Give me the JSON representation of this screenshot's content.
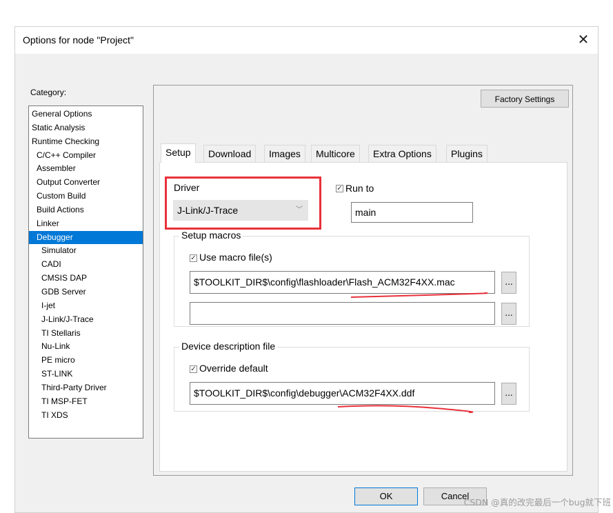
{
  "window": {
    "title": "Options for node \"Project\"",
    "close_icon": "close-icon"
  },
  "category": {
    "label": "Category:",
    "items": [
      {
        "label": "General Options",
        "level": 0
      },
      {
        "label": "Static Analysis",
        "level": 0
      },
      {
        "label": "Runtime Checking",
        "level": 0
      },
      {
        "label": "C/C++ Compiler",
        "level": 1
      },
      {
        "label": "Assembler",
        "level": 1
      },
      {
        "label": "Output Converter",
        "level": 1
      },
      {
        "label": "Custom Build",
        "level": 1
      },
      {
        "label": "Build Actions",
        "level": 1
      },
      {
        "label": "Linker",
        "level": 1
      },
      {
        "label": "Debugger",
        "level": 1,
        "selected": true
      },
      {
        "label": "Simulator",
        "level": 2
      },
      {
        "label": "CADI",
        "level": 2
      },
      {
        "label": "CMSIS DAP",
        "level": 2
      },
      {
        "label": "GDB Server",
        "level": 2
      },
      {
        "label": "I-jet",
        "level": 2
      },
      {
        "label": "J-Link/J-Trace",
        "level": 2
      },
      {
        "label": "TI Stellaris",
        "level": 2
      },
      {
        "label": "Nu-Link",
        "level": 2
      },
      {
        "label": "PE micro",
        "level": 2
      },
      {
        "label": "ST-LINK",
        "level": 2
      },
      {
        "label": "Third-Party Driver",
        "level": 2
      },
      {
        "label": "TI MSP-FET",
        "level": 2
      },
      {
        "label": "TI XDS",
        "level": 2
      }
    ]
  },
  "factory_settings_label": "Factory Settings",
  "tabs": [
    "Setup",
    "Download",
    "Images",
    "Multicore",
    "Extra Options",
    "Plugins"
  ],
  "active_tab": "Setup",
  "setup": {
    "driver_label": "Driver",
    "driver_value": "J-Link/J-Trace",
    "run_to_label": "Run to",
    "run_to_checked": true,
    "run_to_value": "main",
    "setup_macros": {
      "title": "Setup macros",
      "use_macro_label": "Use macro file(s)",
      "use_macro_checked": true,
      "macro_file_1": "$TOOLKIT_DIR$\\config\\flashloader\\Flash_ACM32F4XX.mac",
      "macro_file_2": "",
      "browse_label": "..."
    },
    "device_description": {
      "title": "Device description file",
      "override_label": "Override default",
      "override_checked": true,
      "ddf_file": "$TOOLKIT_DIR$\\config\\debugger\\ACM32F4XX.ddf",
      "browse_label": "..."
    }
  },
  "buttons": {
    "ok": "OK",
    "cancel": "Cancel"
  },
  "watermark": "CSDN @真的改完最后一个bug就下班",
  "colors": {
    "selection": "#0078d7",
    "highlight_box": "#e8303a",
    "underline": "#e8303a"
  }
}
